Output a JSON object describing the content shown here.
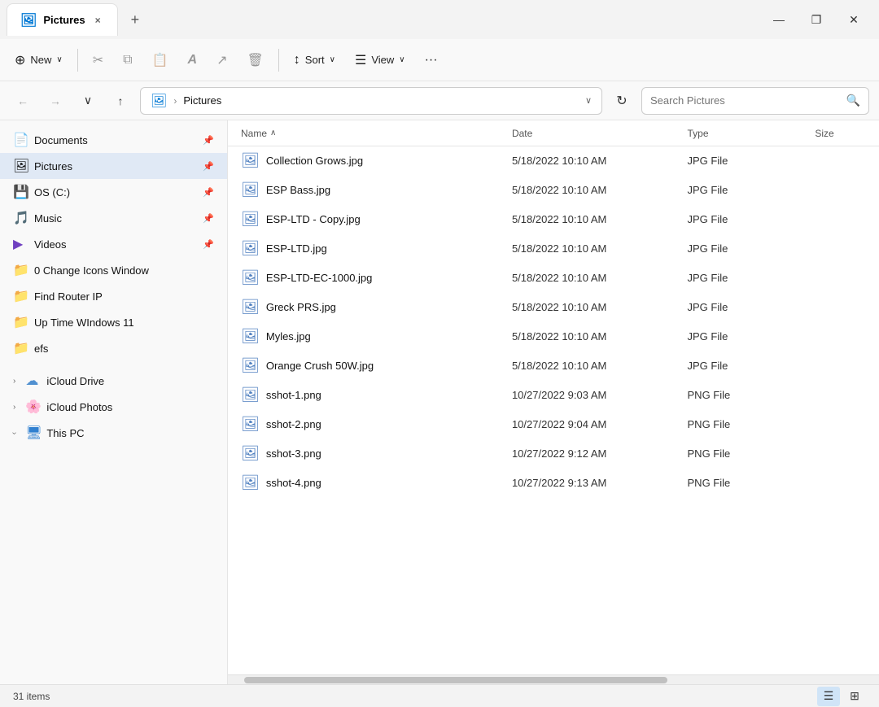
{
  "window": {
    "title": "Pictures",
    "tab_close": "×",
    "tab_add": "+",
    "minimize": "—",
    "maximize": "❐",
    "close": "✕"
  },
  "toolbar": {
    "new_label": "New",
    "new_icon": "⊕",
    "cut_icon": "✂",
    "copy_icon": "⧉",
    "paste_icon": "📋",
    "rename_icon": "𝐴",
    "share_icon": "↗",
    "delete_icon": "🗑",
    "sort_label": "Sort",
    "sort_icon": "↕",
    "view_label": "View",
    "view_icon": "☰",
    "more_icon": "···"
  },
  "addressbar": {
    "back_icon": "←",
    "forward_icon": "→",
    "recent_icon": "∨",
    "up_icon": "↑",
    "path_icon": "🖼",
    "path_root": "Pictures",
    "path_sep": "›",
    "dropdown_icon": "∨",
    "refresh_icon": "↻",
    "search_placeholder": "Search Pictures",
    "search_icon": "🔍"
  },
  "sidebar": {
    "items": [
      {
        "id": "documents",
        "label": "Documents",
        "icon": "📄",
        "pinned": true,
        "active": false
      },
      {
        "id": "pictures",
        "label": "Pictures",
        "icon": "🖼",
        "pinned": true,
        "active": true
      },
      {
        "id": "os-c",
        "label": "OS (C:)",
        "icon": "💾",
        "pinned": true,
        "active": false
      },
      {
        "id": "music",
        "label": "Music",
        "icon": "🎵",
        "pinned": true,
        "active": false
      },
      {
        "id": "videos",
        "label": "Videos",
        "icon": "▶",
        "pinned": true,
        "active": false
      },
      {
        "id": "change-icons",
        "label": "0 Change Icons Window",
        "icon": "📁",
        "pinned": false,
        "active": false
      },
      {
        "id": "find-router",
        "label": "Find Router IP",
        "icon": "📁",
        "pinned": false,
        "active": false
      },
      {
        "id": "uptime",
        "label": "Up Time WIndows 11",
        "icon": "📁",
        "pinned": false,
        "active": false
      },
      {
        "id": "efs",
        "label": "efs",
        "icon": "📁",
        "pinned": false,
        "active": false
      }
    ],
    "groups": [
      {
        "id": "icloud-drive",
        "label": "iCloud Drive",
        "icon": "☁",
        "expanded": false
      },
      {
        "id": "icloud-photos",
        "label": "iCloud Photos",
        "icon": "🌸",
        "expanded": false
      },
      {
        "id": "this-pc",
        "label": "This PC",
        "icon": "🖥",
        "expanded": true
      }
    ]
  },
  "file_list": {
    "columns": {
      "name": "Name",
      "date": "Date",
      "type": "Type",
      "size": "Size"
    },
    "sort_icon": "∧",
    "files": [
      {
        "name": "Collection Grows.jpg",
        "date": "5/18/2022 10:10 AM",
        "type": "JPG File",
        "size": ""
      },
      {
        "name": "ESP Bass.jpg",
        "date": "5/18/2022 10:10 AM",
        "type": "JPG File",
        "size": ""
      },
      {
        "name": "ESP-LTD - Copy.jpg",
        "date": "5/18/2022 10:10 AM",
        "type": "JPG File",
        "size": ""
      },
      {
        "name": "ESP-LTD.jpg",
        "date": "5/18/2022 10:10 AM",
        "type": "JPG File",
        "size": ""
      },
      {
        "name": "ESP-LTD-EC-1000.jpg",
        "date": "5/18/2022 10:10 AM",
        "type": "JPG File",
        "size": ""
      },
      {
        "name": "Greck PRS.jpg",
        "date": "5/18/2022 10:10 AM",
        "type": "JPG File",
        "size": ""
      },
      {
        "name": "Myles.jpg",
        "date": "5/18/2022 10:10 AM",
        "type": "JPG File",
        "size": ""
      },
      {
        "name": "Orange Crush 50W.jpg",
        "date": "5/18/2022 10:10 AM",
        "type": "JPG File",
        "size": ""
      },
      {
        "name": "sshot-1.png",
        "date": "10/27/2022 9:03 AM",
        "type": "PNG File",
        "size": ""
      },
      {
        "name": "sshot-2.png",
        "date": "10/27/2022 9:04 AM",
        "type": "PNG File",
        "size": ""
      },
      {
        "name": "sshot-3.png",
        "date": "10/27/2022 9:12 AM",
        "type": "PNG File",
        "size": ""
      },
      {
        "name": "sshot-4.png",
        "date": "10/27/2022 9:13 AM",
        "type": "PNG File",
        "size": ""
      }
    ]
  },
  "status_bar": {
    "count": "31 items",
    "view_list_icon": "☰",
    "view_grid_icon": "⊞"
  }
}
